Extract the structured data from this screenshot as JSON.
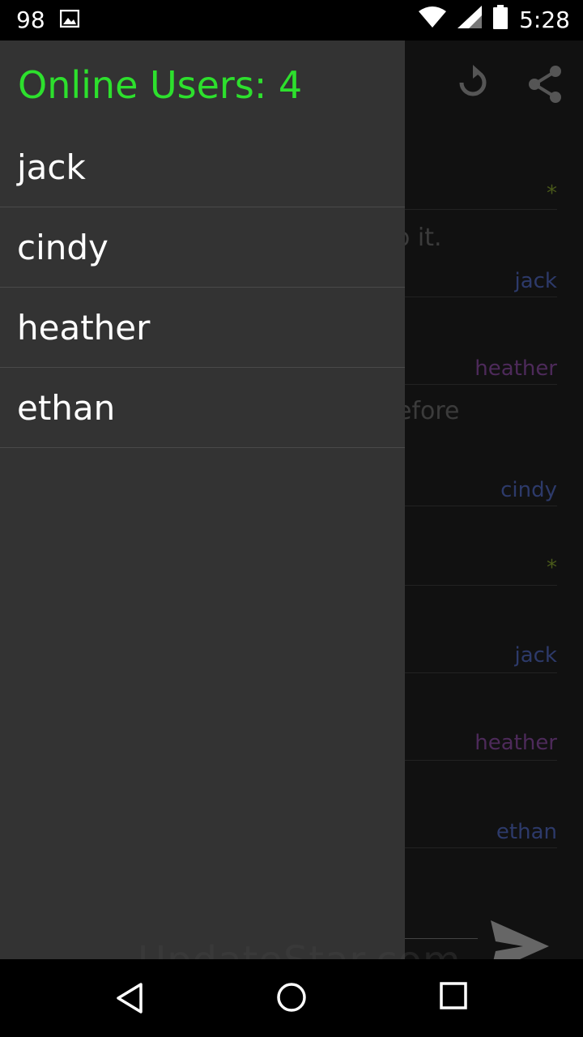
{
  "status_bar": {
    "notification_count": "98",
    "time": "5:28",
    "icons": [
      "image-icon",
      "wifi-icon",
      "signal-icon",
      "battery-icon"
    ]
  },
  "toolbar": {
    "icons": [
      "refresh-icon",
      "share-icon"
    ]
  },
  "chat_background": {
    "messages": [
      {
        "name": "*",
        "text": ""
      },
      {
        "name": "jack",
        "text": "o it."
      },
      {
        "name": "heather",
        "text": ""
      },
      {
        "name": "cindy",
        "text": "efore"
      },
      {
        "name": "*",
        "text": ""
      },
      {
        "name": "jack",
        "text": ""
      },
      {
        "name": "heather",
        "text": ""
      },
      {
        "name": "ethan",
        "text": ""
      }
    ],
    "name_colors": {
      "jack": "#2d3a6a",
      "heather": "#4d2a5a",
      "cindy": "#2d3a6a",
      "ethan": "#2d3a6a",
      "*": "#4a5a1a"
    }
  },
  "drawer": {
    "title": "Online Users: 4",
    "title_color": "#2de02d",
    "users": [
      "jack",
      "cindy",
      "heather",
      "ethan"
    ]
  },
  "watermark": "UpdateStar.com",
  "nav_bar": {
    "icons": [
      "back-icon",
      "home-icon",
      "recents-icon"
    ]
  }
}
